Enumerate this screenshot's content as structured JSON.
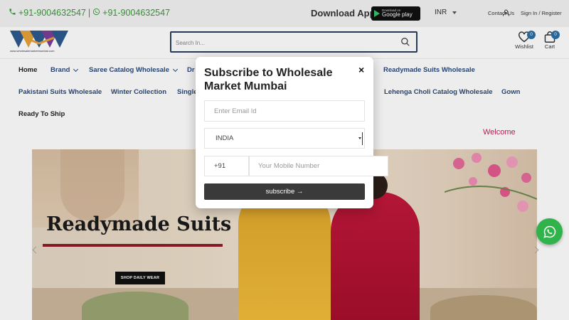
{
  "topbar": {
    "phone_1": "+91-9004632547",
    "separator": "|",
    "phone_2": "+91-9004632547",
    "download_app": "Download App",
    "google_play_small": "Download on",
    "google_play_big": "Google play",
    "currency": "INR",
    "contact": "Contact Us",
    "signin": "Sign In",
    "signin_sep": "/",
    "register": "Register",
    "phone_color": "#3a9a3a"
  },
  "header": {
    "logo_text": "www.wholesalemarketmumbai.com",
    "search_placeholder": "Search In...",
    "wishlist_label": "Wishlist",
    "wishlist_count": "0",
    "cart_label": "Cart",
    "cart_count": "0",
    "badge_color": "#2b6fa6"
  },
  "nav": {
    "items": [
      {
        "label": "Home"
      },
      {
        "label": "Brand"
      },
      {
        "label": "Saree Catalog Wholesale"
      },
      {
        "label": "Dr"
      },
      {
        "label": "Readymade Suits Wholesale"
      },
      {
        "label": "Pakistani Suits Wholesale"
      },
      {
        "label": "Winter Collection"
      },
      {
        "label": "Single"
      },
      {
        "label": "Lehenga Choli Catalog Wholesale"
      },
      {
        "label": "Gown"
      },
      {
        "label": "Ready To Ship"
      }
    ],
    "welcome": "Welcome"
  },
  "banner": {
    "title": "Readymade Suits",
    "button": "SHOP DAILY WEAR"
  },
  "modal": {
    "title": "Subscribe to Wholesale Market Mumbai",
    "close": "×",
    "email_placeholder": "Enter Email Id",
    "country": "INDIA",
    "country_code": "+91",
    "mobile_placeholder": "Your Mobile Number",
    "subscribe_label": "subscribe →"
  },
  "icons": {
    "whatsapp": "whatsapp-icon",
    "search": "search-icon",
    "wishlist": "heart-icon",
    "cart": "bag-icon",
    "user": "user-icon"
  },
  "colors": {
    "nav_text": "#2b4a7a",
    "search_border": "#2b3f5c",
    "welcome": "#c0255a",
    "whatsapp": "#2fb34a",
    "subscribe_bg": "#3a3a3a"
  }
}
